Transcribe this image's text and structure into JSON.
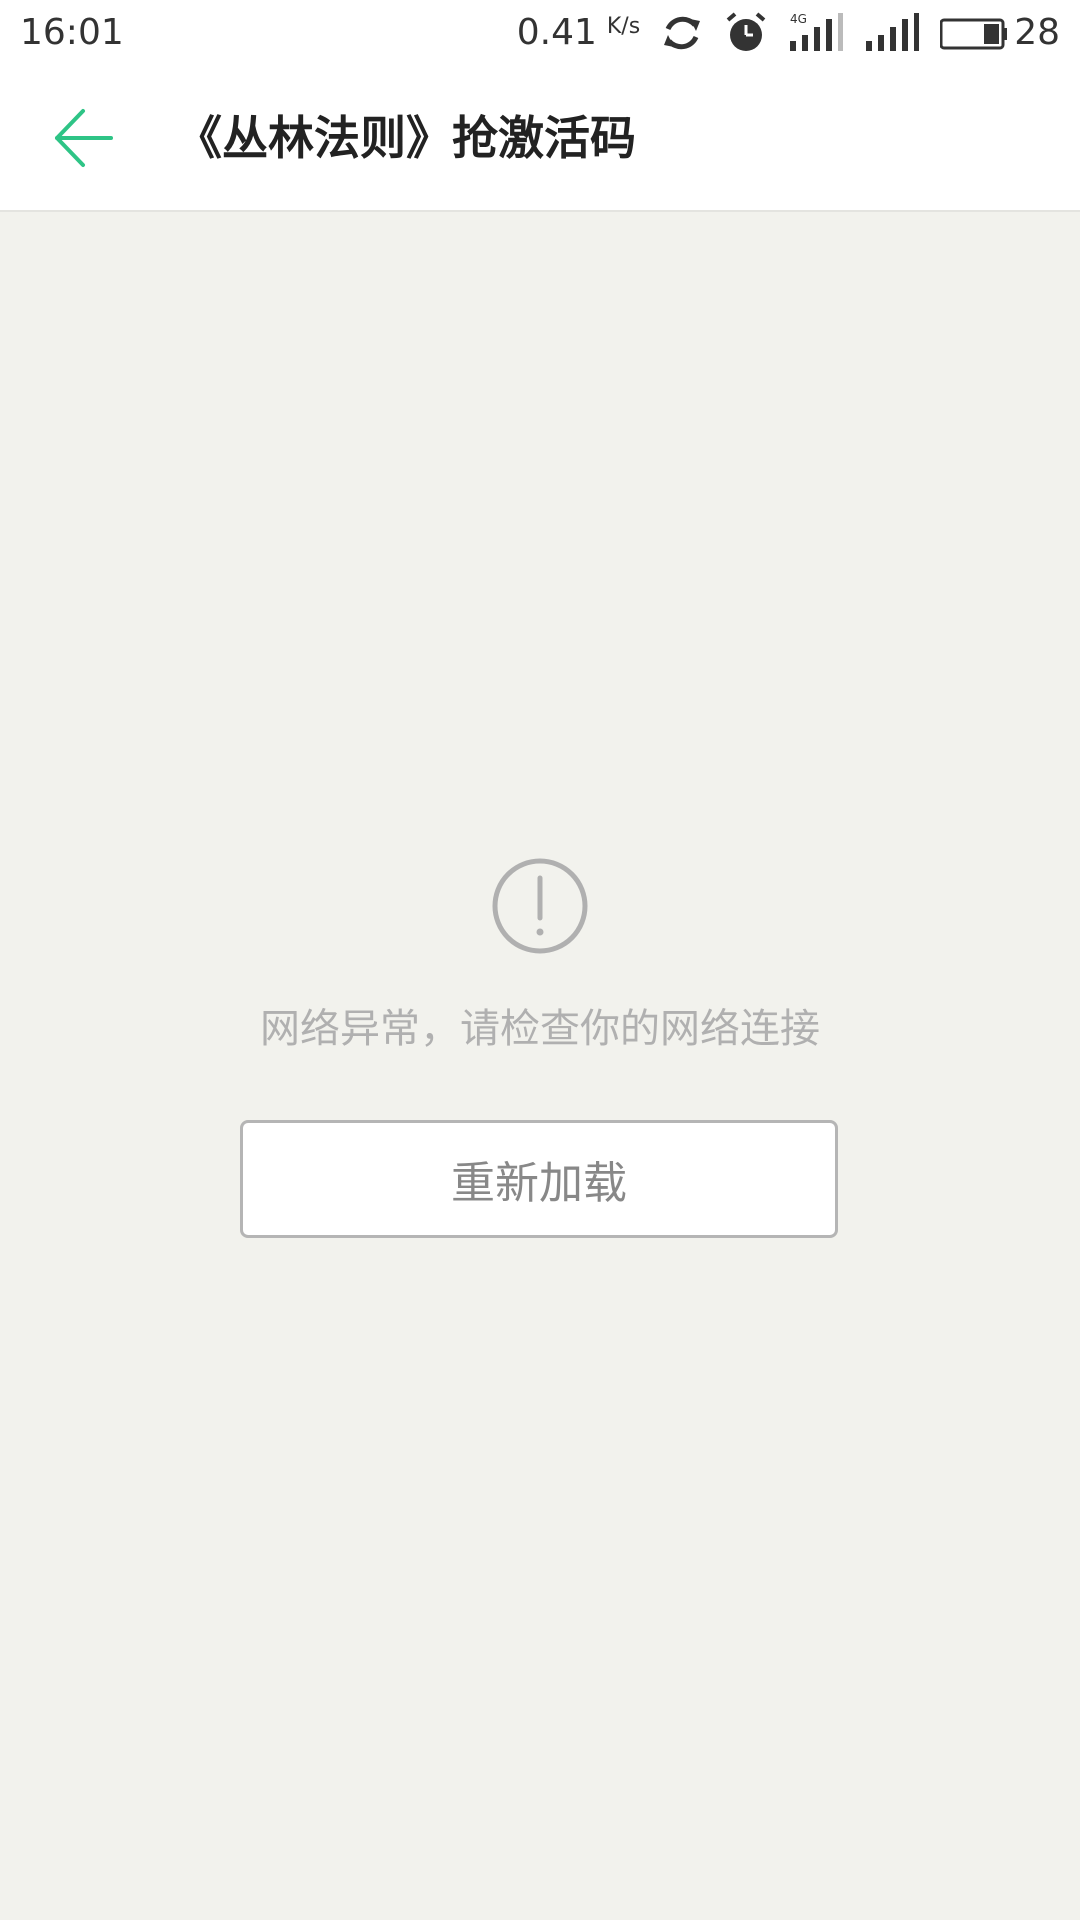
{
  "status_bar": {
    "time": "16:01",
    "net_speed": "0.41",
    "net_speed_unit": "K/s",
    "battery_percent": "28",
    "icons": [
      "sync-icon",
      "alarm-icon",
      "signal-4g-icon",
      "signal-icon",
      "battery-icon"
    ]
  },
  "header": {
    "back_icon": "back-arrow-icon",
    "title": "《丛林法则》抢激活码"
  },
  "error": {
    "icon": "exclamation-circle-icon",
    "message": "网络异常，请检查你的网络连接",
    "reload_label": "重新加载"
  },
  "colors": {
    "accent": "#2ec486",
    "background": "#f2f2ed",
    "error_text": "#b0b0b0"
  }
}
